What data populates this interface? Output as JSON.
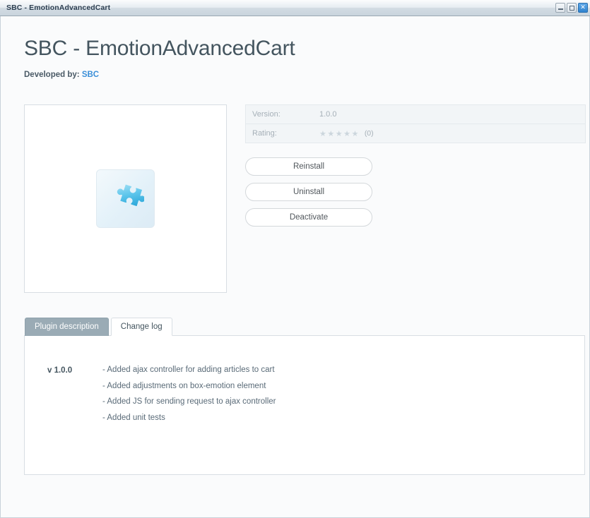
{
  "window": {
    "title": "SBC - EmotionAdvancedCart",
    "buttons": {
      "minimize": "–",
      "maximize": "□",
      "close": "✕"
    }
  },
  "header": {
    "title": "SBC - EmotionAdvancedCart",
    "developed_by_label": "Developed by:",
    "developer": "SBC"
  },
  "preview": {
    "icon": "puzzle-piece-icon"
  },
  "info": {
    "rows": [
      {
        "label": "Version:",
        "value": "1.0.0"
      },
      {
        "label": "Rating:",
        "stars": "★★★★★",
        "count": "(0)"
      }
    ]
  },
  "actions": [
    {
      "label": "Reinstall"
    },
    {
      "label": "Uninstall"
    },
    {
      "label": "Deactivate"
    }
  ],
  "tabs": [
    {
      "label": "Plugin description",
      "active": true
    },
    {
      "label": "Change log",
      "active": false
    }
  ],
  "changelog": {
    "version": "v 1.0.0",
    "items": [
      "- Added ajax controller for adding articles to cart",
      "- Added adjustments on box-emotion element",
      "- Added JS for sending request to ajax controller",
      "- Added unit tests"
    ]
  },
  "colors": {
    "accent_link": "#3b8fd8",
    "tab_active_bg": "#9aabb5",
    "title_text": "#44555f",
    "star_gray": "#ccd6dd",
    "close_button": "#2f82cf"
  }
}
